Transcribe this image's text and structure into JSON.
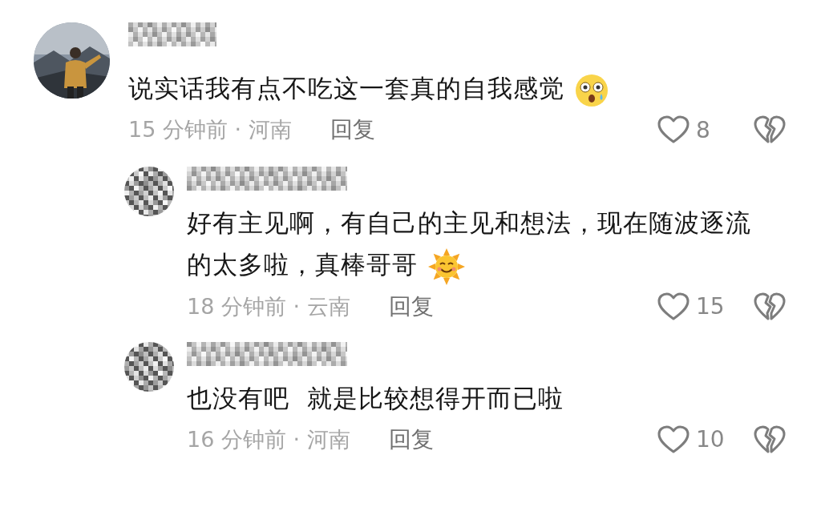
{
  "comments": [
    {
      "text": "说实话我有点不吃这一套真的自我感觉",
      "emoji": {
        "kind": "astonished"
      },
      "meta": "15 分钟前 · 河南",
      "reply": "回复",
      "likes": "8",
      "children": [
        {
          "avatar": {
            "kind": "blurred"
          },
          "text": "好有主见啊，有自己的主见和想法，现在随波逐流的太多啦，真棒哥哥",
          "emoji": {
            "kind": "sun"
          },
          "meta": "18 分钟前 · 云南",
          "reply": "回复",
          "likes": "15"
        },
        {
          "avatar": {
            "kind": "blurred"
          },
          "text": "也没有吧  就是比较想得开而已啦",
          "meta": "16 分钟前 · 河南",
          "reply": "回复",
          "likes": "10"
        }
      ]
    }
  ]
}
